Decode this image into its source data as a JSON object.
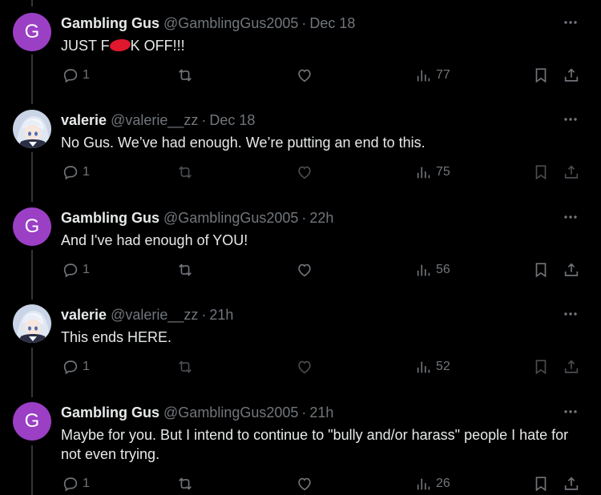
{
  "tweets": [
    {
      "avatar_letter": "G",
      "name": "Gambling Gus",
      "handle": "@GamblingGus2005",
      "separator": "·",
      "time": "Dec 18",
      "text_before": "JUST F",
      "text_after": "K OFF!!!",
      "reply_count": "1",
      "views": "77"
    },
    {
      "name": "valerie",
      "handle": "@valerie__zz",
      "separator": "·",
      "time": "Dec 18",
      "text": "No Gus. We’ve had enough. We’re putting an end to this.",
      "reply_count": "1",
      "views": "75"
    },
    {
      "avatar_letter": "G",
      "name": "Gambling Gus",
      "handle": "@GamblingGus2005",
      "separator": "·",
      "time": "22h",
      "text": "And I've had enough of YOU!",
      "reply_count": "1",
      "views": "56"
    },
    {
      "name": "valerie",
      "handle": "@valerie__zz",
      "separator": "·",
      "time": "21h",
      "text": "This ends HERE.",
      "reply_count": "1",
      "views": "52"
    },
    {
      "avatar_letter": "G",
      "name": "Gambling Gus",
      "handle": "@GamblingGus2005",
      "separator": "·",
      "time": "21h",
      "text": "Maybe for you. But I intend to continue to \"bully and/or harass\" people I hate for not even trying.",
      "reply_count": "1",
      "views": "26"
    }
  ],
  "icons": {
    "more": "more-icon",
    "reply": "reply-icon",
    "retweet": "retweet-icon",
    "like": "heart-icon",
    "views": "views-icon",
    "bookmark": "bookmark-icon",
    "share": "share-icon"
  },
  "colors": {
    "background": "#000000",
    "avatar_g": "#9b3fc5",
    "text": "#e7e9ea",
    "muted": "#71767b",
    "censor": "#e0182d"
  }
}
